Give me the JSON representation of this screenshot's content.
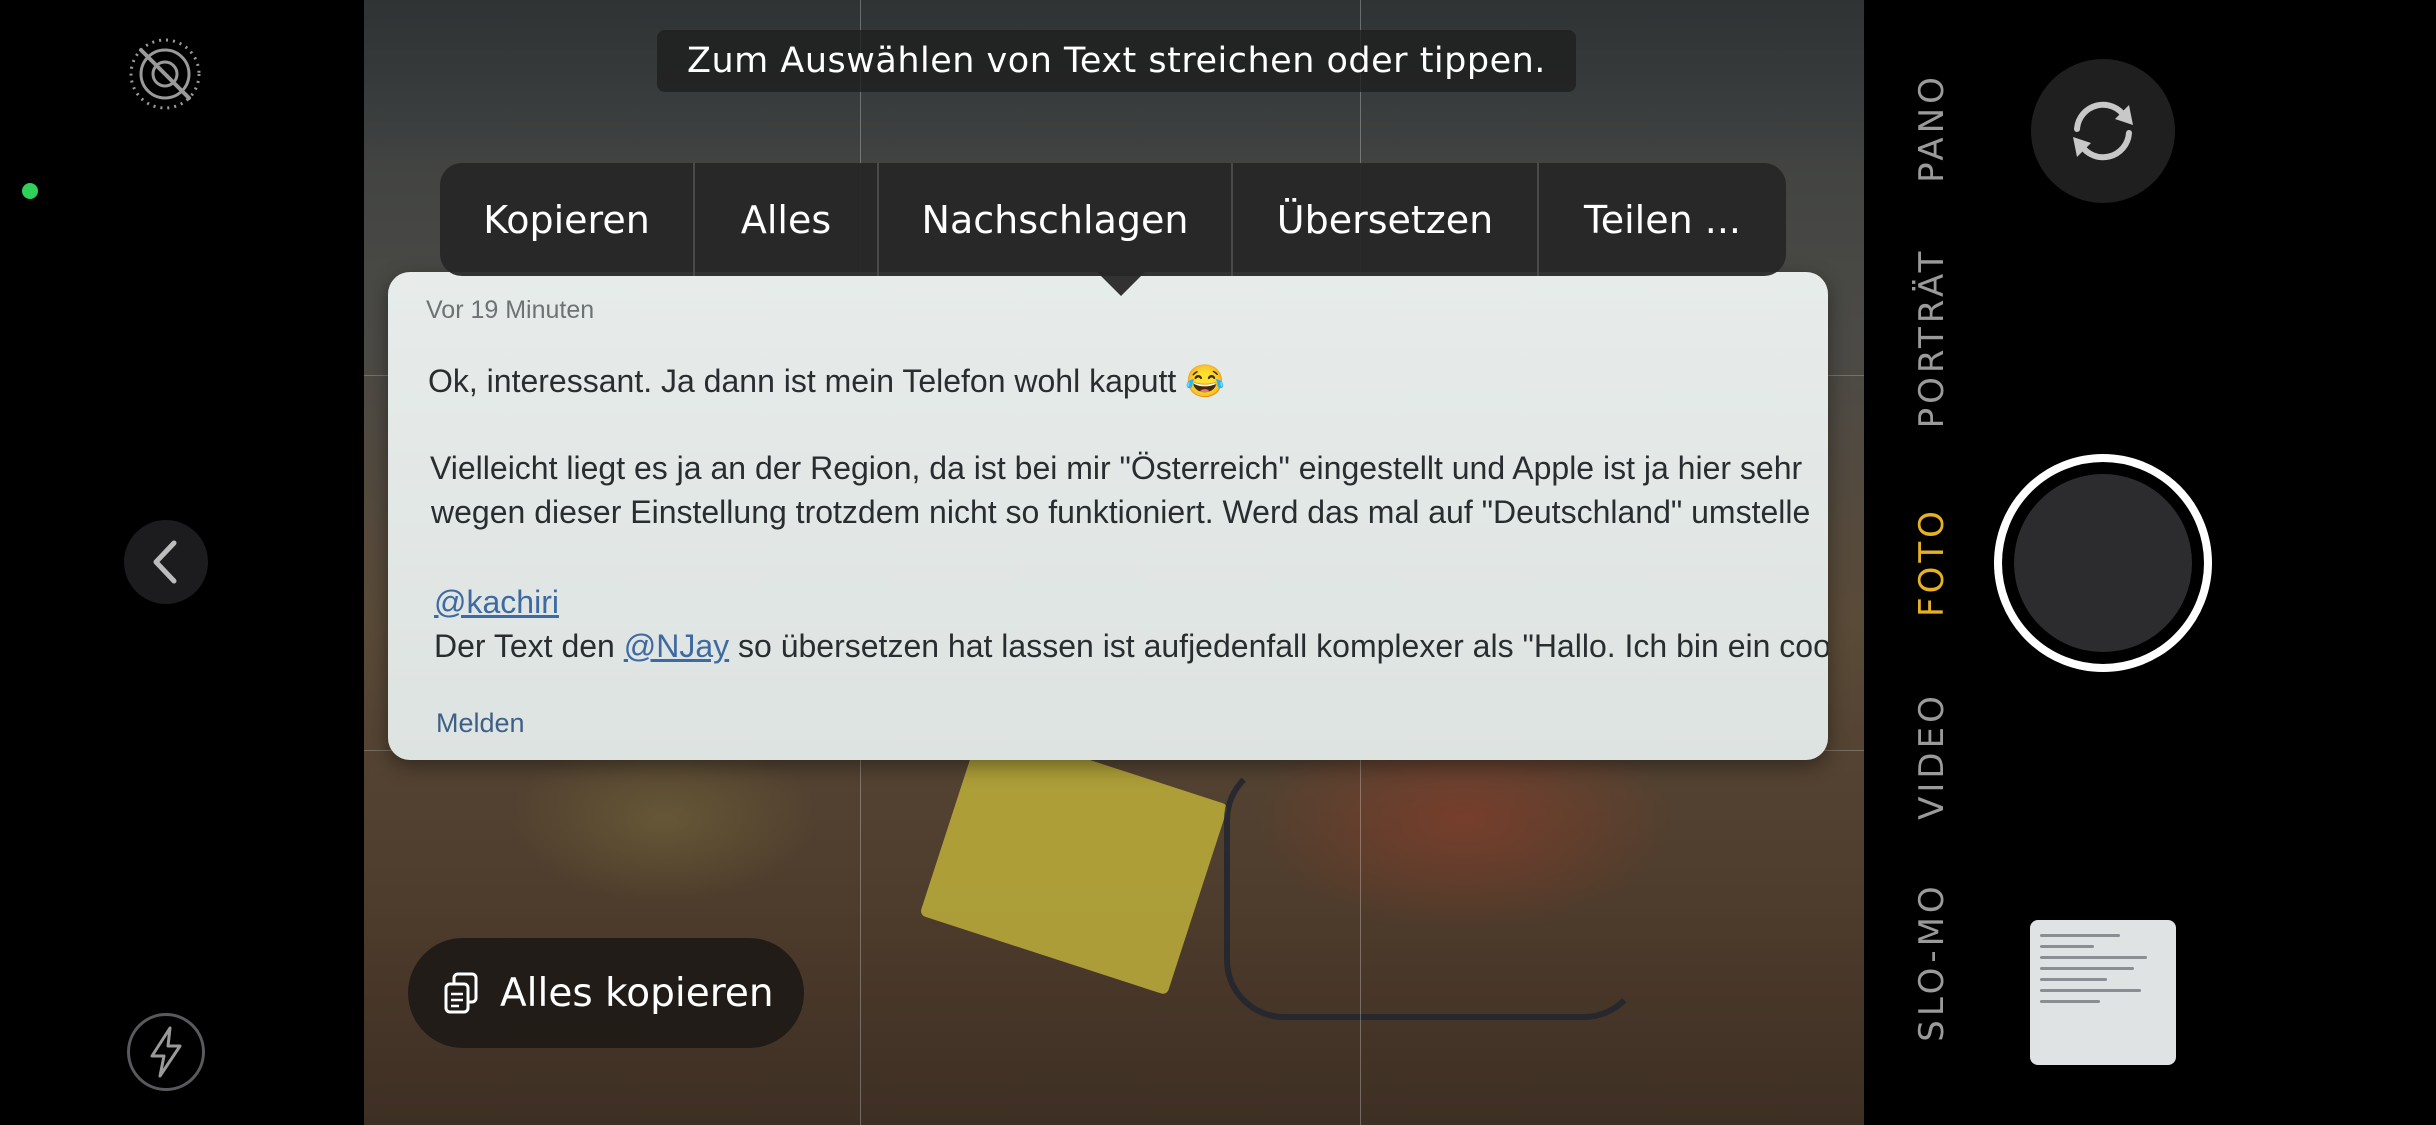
{
  "hint": "Zum Auswählen von Text streichen oder tippen.",
  "menu": {
    "items": [
      "Kopieren",
      "Alles",
      "Nachschlagen",
      "Übersetzen",
      "Teilen ..."
    ]
  },
  "card": {
    "time": "Vor 19 Minuten",
    "line1": "Ok, interessant. Ja dann ist mein Telefon wohl kaputt 😂",
    "line2": "Vielleicht liegt es ja an der Region, da ist bei mir \"Österreich\" eingestellt und Apple ist ja hier sehr",
    "line3": "wegen dieser Einstellung trotzdem nicht so funktioniert. Werd das mal auf \"Deutschland\" umstelle",
    "mention1": "@kachiri",
    "line4_pre": "Der Text den ",
    "mention2": "@NJay",
    "line4_post": " so übersetzen hat lassen ist aufjedenfall komplexer als \"Hallo. Ich bin ein cool",
    "report": "Melden"
  },
  "copy_all": "Alles kopieren",
  "modes": {
    "pano": "PANO",
    "portrait": "PORTRÄT",
    "photo": "FOTO",
    "video": "VIDEO",
    "slomo": "SLO-MO"
  },
  "colors": {
    "accent_yellow": "#f6d32d",
    "active_mode": "#e6b223",
    "indicator_green": "#30d158"
  }
}
